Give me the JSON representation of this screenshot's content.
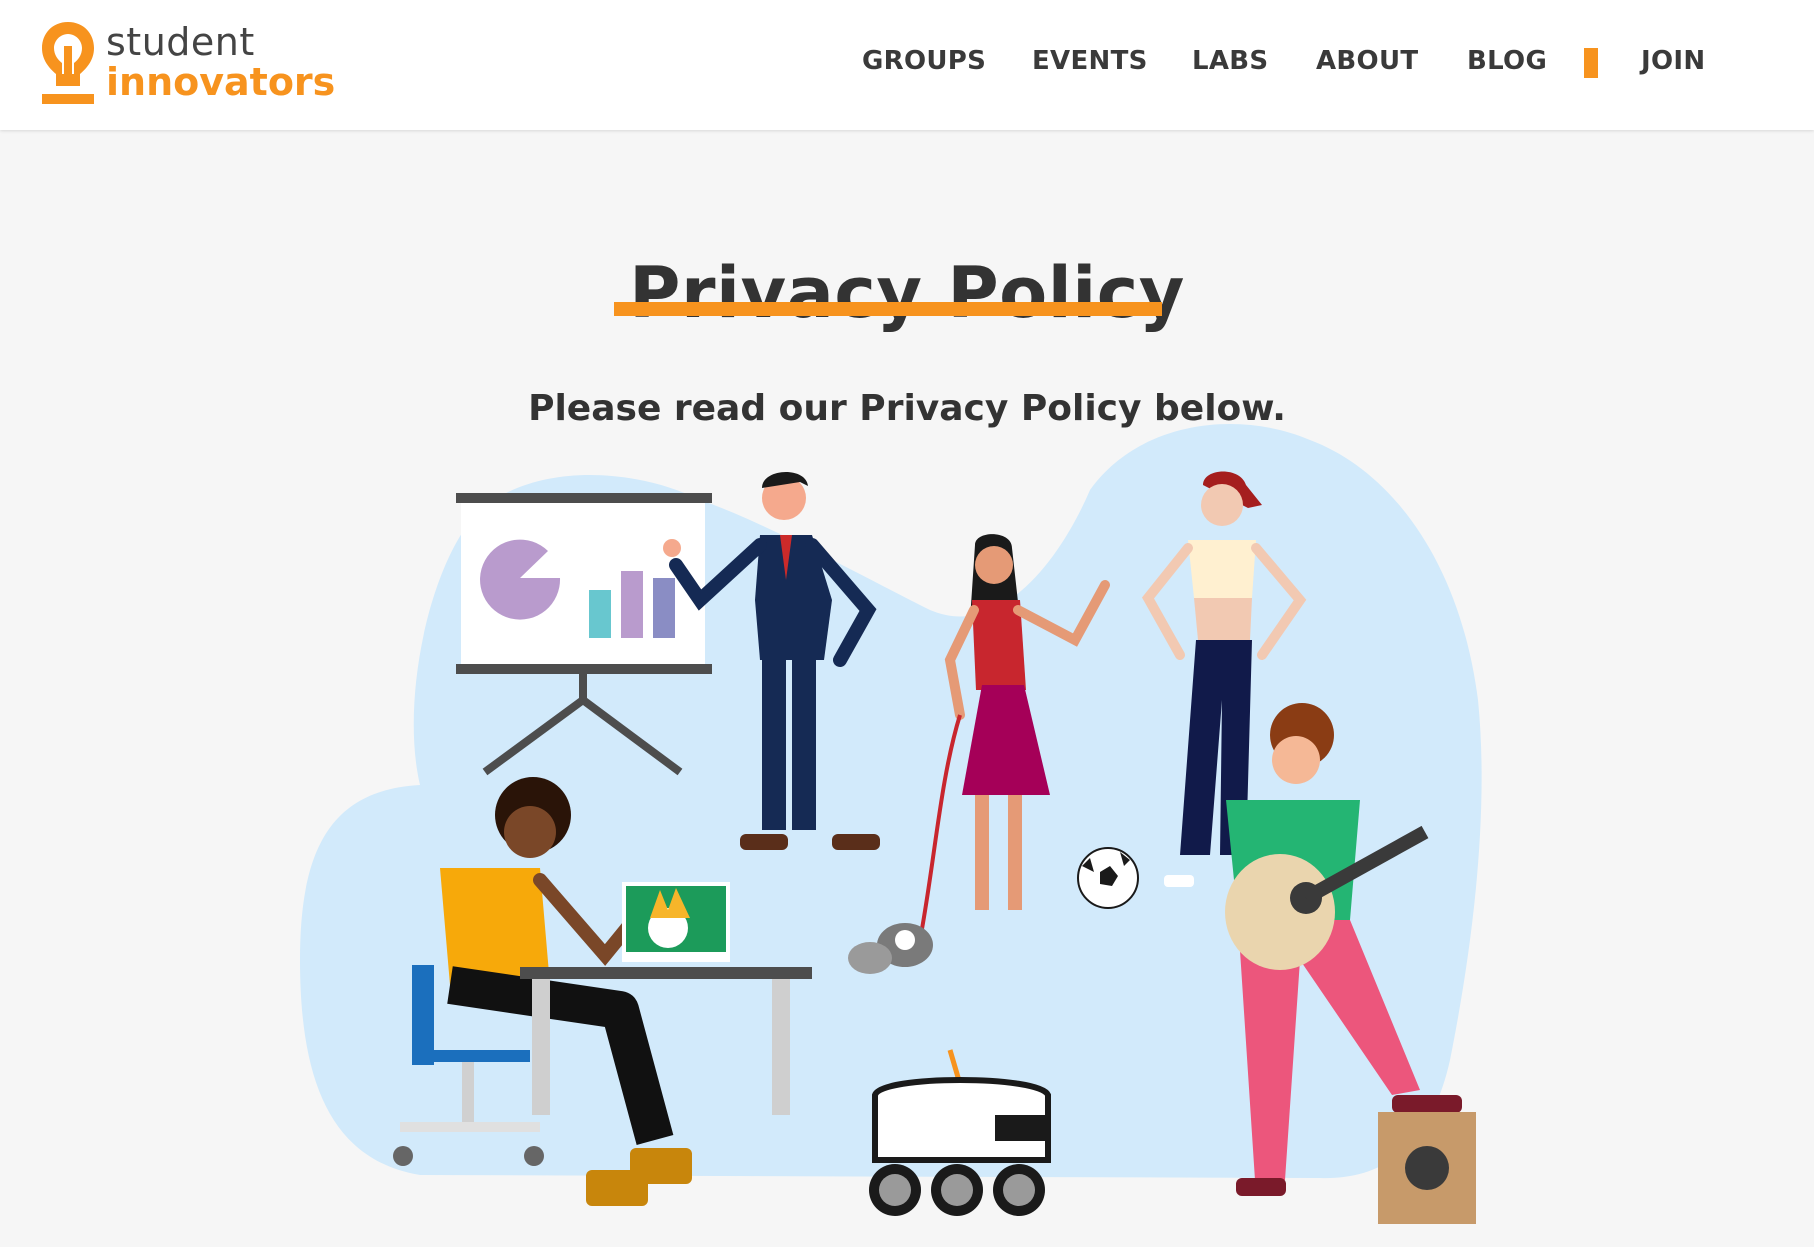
{
  "brand": {
    "line1": "student",
    "line2": "innovators",
    "accent_color": "#f7931e",
    "icon": "lightbulb-icon"
  },
  "nav": {
    "items": [
      {
        "label": "GROUPS"
      },
      {
        "label": "EVENTS"
      },
      {
        "label": "LABS"
      },
      {
        "label": "ABOUT"
      },
      {
        "label": "BLOG"
      },
      {
        "label": "JOIN"
      }
    ]
  },
  "hero": {
    "title": "Privacy Policy",
    "subtitle": "Please read our Privacy Policy below."
  },
  "colors": {
    "page_background": "#f6f6f6",
    "header_background": "#ffffff",
    "illustration_blob": "#d2eafb",
    "text": "#333333"
  }
}
